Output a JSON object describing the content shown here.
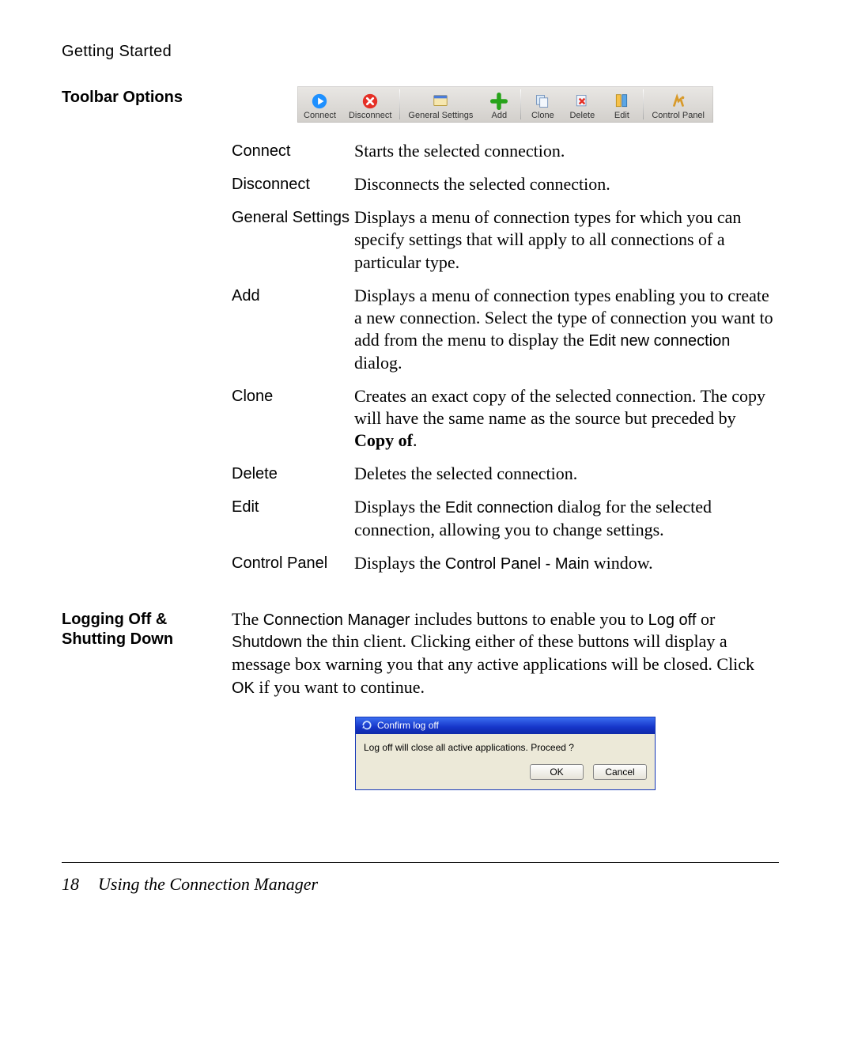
{
  "running_head": "Getting Started",
  "heading_toolbar": "Toolbar Options",
  "toolbar": {
    "connect": "Connect",
    "disconnect": "Disconnect",
    "general_settings": "General Settings",
    "add": "Add",
    "clone": "Clone",
    "delete": "Delete",
    "edit": "Edit",
    "control_panel": "Control Panel"
  },
  "defs": {
    "connect": {
      "term": "Connect",
      "desc": "Starts the selected connection."
    },
    "disconnect": {
      "term": "Disconnect",
      "desc": "Disconnects the selected connection."
    },
    "general": {
      "term": "General Settings",
      "desc": "Displays a menu of connection types for which you can specify settings that will apply to all connections of a particular type."
    },
    "add": {
      "term": "Add",
      "desc_pre": "Displays a menu of connection types enabling you to create a new connection. Select the type of connection you want to add from the menu to display the ",
      "dialog_name": "Edit new connection",
      "desc_post": " dialog."
    },
    "clone": {
      "term": "Clone",
      "desc_pre": "Creates an exact copy of the selected connection. The copy will have the same name as the source but preceded by ",
      "bold": "Copy of",
      "desc_post": "."
    },
    "delete": {
      "term": "Delete",
      "desc": "Deletes the selected connection."
    },
    "edit": {
      "term": "Edit",
      "desc_pre": "Displays the ",
      "dialog_name": "Edit connection",
      "desc_post": " dialog for the selected connection, allowing you to change settings."
    },
    "cpanel": {
      "term": "Control Panel",
      "desc_pre": "Displays the ",
      "dialog_name": "Control Panel - Main",
      "desc_post": " window."
    }
  },
  "heading_logoff": "Logging Off & Shutting Down",
  "logoff_para": {
    "p1": "The ",
    "cm": "Connection Manager",
    "p2": " includes buttons to enable you to ",
    "logoff": "Log off",
    "p3": " or ",
    "shutdown": "Shutdown",
    "p4": " the thin client. Clicking either of these buttons will display a message box warning you that any active applications will be closed. Click ",
    "ok": "OK",
    "p5": " if you want to continue."
  },
  "dialog": {
    "title": "Confirm log off",
    "message": "Log off will close all active applications. Proceed ?",
    "ok": "OK",
    "cancel": "Cancel"
  },
  "footer": {
    "page": "18",
    "title": "Using the Connection Manager"
  }
}
